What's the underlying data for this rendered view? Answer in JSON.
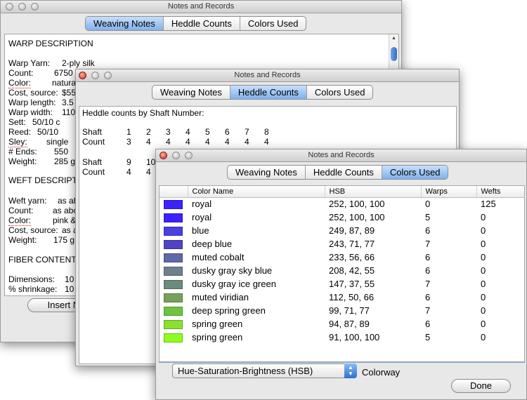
{
  "windows": {
    "w1": {
      "title": "Notes and Records"
    },
    "w2": {
      "title": "Notes and Records"
    },
    "w3": {
      "title": "Notes and Records"
    }
  },
  "tabs": {
    "weaving": "Weaving Notes",
    "heddle": "Heddle Counts",
    "colors": "Colors Used"
  },
  "w1_notes": {
    "warp_heading": "WARP DESCRIPTION",
    "rows": [
      {
        "label": "Warp Yarn:",
        "value": "2-ply silk"
      },
      {
        "label": "Count:",
        "value": "6750 y"
      },
      {
        "label": "Color:",
        "value": "natura"
      },
      {
        "label": "Cost, source:",
        "value": "$55"
      },
      {
        "label": "Warp length:",
        "value": "3.5"
      },
      {
        "label": "Warp width:",
        "value": "110"
      },
      {
        "label": "Sett:",
        "value": "50/10 c"
      },
      {
        "label": "Reed:",
        "value": "50/10"
      },
      {
        "label": "Sley:",
        "value": "single"
      },
      {
        "label": "# Ends:",
        "value": "550"
      },
      {
        "label": "Weight:",
        "value": "285 g"
      }
    ],
    "weft_heading": "WEFT DESCRIPT",
    "weft_rows": [
      {
        "label": "Weft yarn:",
        "value": "as ab"
      },
      {
        "label": "Count:",
        "value": "as abc"
      },
      {
        "label": "Color:",
        "value": "pink &"
      },
      {
        "label": "Cost, source:",
        "value": "as a"
      },
      {
        "label": "Weight:",
        "value": "175 g"
      }
    ],
    "fiber_heading": "FIBER CONTENT",
    "dim_rows": [
      {
        "label": "Dimensions:",
        "value": "10"
      },
      {
        "label": "% shrinkage:",
        "value": "10"
      }
    ],
    "insert_button": "Insert No"
  },
  "w2_heddle": {
    "heading": "Heddle counts by Shaft Number:",
    "row1_label_shaft": "Shaft",
    "row1_shafts": [
      "1",
      "2",
      "3",
      "4",
      "5",
      "6",
      "7",
      "8"
    ],
    "row1_label_count": "Count",
    "row1_counts": [
      "3",
      "4",
      "4",
      "4",
      "4",
      "4",
      "4",
      "4"
    ],
    "row2_label_shaft": "Shaft",
    "row2_shafts": [
      "9",
      "10"
    ],
    "row2_label_count": "Count",
    "row2_counts": [
      "4",
      "4"
    ]
  },
  "w3_colors": {
    "columns": [
      "Color Name",
      "HSB",
      "Warps",
      "Wefts"
    ],
    "rows": [
      {
        "swatch": "#3c22ff",
        "name": "royal",
        "hsb": "252, 100, 100",
        "warps": "0",
        "wefts": "125"
      },
      {
        "swatch": "#3c22ff",
        "name": "royal",
        "hsb": "252, 100, 100",
        "warps": "5",
        "wefts": "0"
      },
      {
        "swatch": "#4a3fe4",
        "name": "blue",
        "hsb": "249, 87, 89",
        "warps": "6",
        "wefts": "0"
      },
      {
        "swatch": "#5043c4",
        "name": "deep blue",
        "hsb": "243, 71, 77",
        "warps": "7",
        "wefts": "0"
      },
      {
        "swatch": "#5f68a8",
        "name": "muted cobalt",
        "hsb": "233, 56, 66",
        "warps": "6",
        "wefts": "0"
      },
      {
        "swatch": "#6f7f8c",
        "name": "dusky  gray sky blue",
        "hsb": "208, 42, 55",
        "warps": "6",
        "wefts": "0"
      },
      {
        "swatch": "#6b8c7c",
        "name": "dusky  gray ice green",
        "hsb": "147, 37, 55",
        "warps": "7",
        "wefts": "0"
      },
      {
        "swatch": "#76a15a",
        "name": "muted viridian",
        "hsb": "112, 50, 66",
        "warps": "6",
        "wefts": "0"
      },
      {
        "swatch": "#6ec43f",
        "name": "deep spring green",
        "hsb": "99, 71, 77",
        "warps": "7",
        "wefts": "0"
      },
      {
        "swatch": "#88e12d",
        "name": "spring green",
        "hsb": "94, 87, 89",
        "warps": "6",
        "wefts": "0"
      },
      {
        "swatch": "#8cff1c",
        "name": "spring green",
        "hsb": "91, 100, 100",
        "warps": "5",
        "wefts": "0"
      }
    ],
    "select_value": "Hue-Saturation-Brightness (HSB)",
    "colorway_label": "Colorway",
    "done_button": "Done"
  }
}
